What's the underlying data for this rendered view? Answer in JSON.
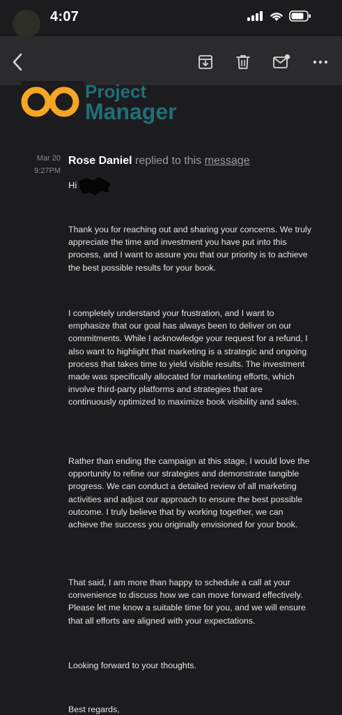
{
  "status_bar": {
    "time": "4:07"
  },
  "toolbar": {
    "back_icon": "chevron-left-icon",
    "archive_icon": "archive-icon",
    "trash_icon": "trash-icon",
    "mark_unread_icon": "mail-unread-icon",
    "more_icon": "more-horizontal-icon"
  },
  "logo": {
    "line1": "Project",
    "line2": "Manager",
    "mark": "36"
  },
  "message": {
    "date": "Mar 20",
    "time": "9:27PM",
    "sender": "Rose Daniel",
    "replied_text": "replied to this",
    "link_text": "message",
    "greeting": "Hi",
    "paragraphs": [
      "Thank you for reaching out and sharing your concerns. We truly appreciate the time and investment you have put into this process, and I want to assure you that our priority is to achieve the best possible results for your book.",
      "I completely understand your frustration, and I want to emphasize that our goal has always been to deliver on our commitments. While I acknowledge your request for a refund, I also want to highlight that marketing is a strategic and ongoing process that takes time to yield visible results. The investment made was specifically allocated for marketing efforts, which involve third-party platforms and strategies that are continuously optimized to maximize book visibility and sales.",
      "Rather than ending the campaign at this stage, I would love the opportunity to refine our strategies and demonstrate tangible progress. We can conduct a detailed review of all marketing activities and adjust our approach to ensure the best possible outcome. I truly believe that by working together, we can achieve the success you originally envisioned for your book.",
      "That said, I am more than happy to schedule a call at your convenience to discuss how we can move forward effectively. Please let me know a suitable time for you, and we will ensure that all efforts are aligned with your expectations.",
      "Looking forward to your thoughts.",
      "Best regards,"
    ]
  },
  "colors": {
    "background": "#1c1c1e",
    "toolbar": "#2b2b2d",
    "logo_orange": "#f5a623",
    "logo_teal": "#1f6f78"
  }
}
